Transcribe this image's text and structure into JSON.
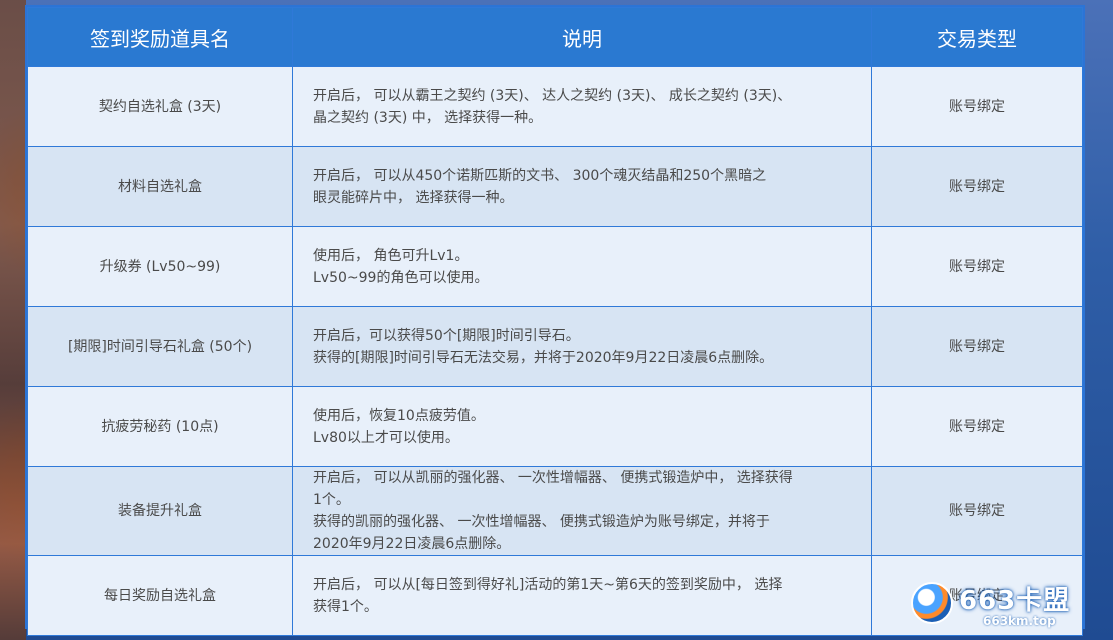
{
  "table": {
    "headers": [
      "签到奖励道具名",
      "说明",
      "交易类型"
    ],
    "rows": [
      {
        "name": "契约自选礼盒 (3天)",
        "desc": [
          "开启后， 可以从霸王之契约 (3天)、 达人之契约 (3天)、 成长之契约 (3天)、",
          "晶之契约 (3天) 中， 选择获得一种。"
        ],
        "type": "账号绑定"
      },
      {
        "name": "材料自选礼盒",
        "desc": [
          "开启后， 可以从450个诺斯匹斯的文书、 300个魂灭结晶和250个黑暗之",
          "眼灵能碎片中， 选择获得一种。"
        ],
        "type": "账号绑定"
      },
      {
        "name": "升级券 (Lv50~99)",
        "desc": [
          "使用后， 角色可升Lv1。",
          "Lv50~99的角色可以使用。"
        ],
        "type": "账号绑定"
      },
      {
        "name": "[期限]时间引导石礼盒 (50个)",
        "desc": [
          "开启后，可以获得50个[期限]时间引导石。",
          "获得的[期限]时间引导石无法交易，并将于2020年9月22日凌晨6点删除。"
        ],
        "type": "账号绑定"
      },
      {
        "name": "抗疲劳秘药 (10点)",
        "desc": [
          "使用后，恢复10点疲劳值。",
          "Lv80以上才可以使用。"
        ],
        "type": "账号绑定"
      },
      {
        "name": "装备提升礼盒",
        "desc": [
          "开启后， 可以从凯丽的强化器、 一次性增幅器、 便携式锻造炉中， 选择获得",
          "1个。",
          "获得的凯丽的强化器、 一次性增幅器、 便携式锻造炉为账号绑定，并将于",
          "2020年9月22日凌晨6点删除。"
        ],
        "type": "账号绑定"
      },
      {
        "name": "每日奖励自选礼盒",
        "desc": [
          "开启后， 可以从[每日签到得好礼]活动的第1天~第6天的签到奖励中， 选择",
          "获得1个。"
        ],
        "type": "账号绑定"
      }
    ]
  },
  "watermark": {
    "brand": "663卡盟",
    "url": "663km.top"
  },
  "colors": {
    "header_bg": "#2a79d1",
    "border": "#2f79d8",
    "row_light": "#e8f0fa",
    "row_dark": "#d7e4f3",
    "text": "#4a4a4a"
  }
}
